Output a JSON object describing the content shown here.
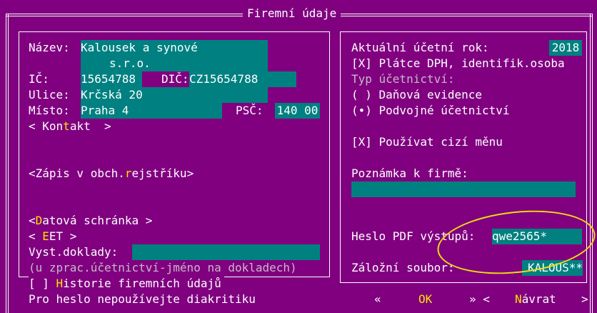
{
  "window": {
    "title": "Firemní údaje"
  },
  "left": {
    "nazev_label": "Název:",
    "nazev_line1": "Kalousek a synové",
    "nazev_line2": "s.r.o.",
    "ic_label": "IČ:",
    "ic_value": "15654788",
    "dic_label": "DIČ:",
    "dic_value": "CZ15654788",
    "ulice_label": "Ulice:",
    "ulice_value": "Krčská 20",
    "misto_label": "Místo:",
    "misto_value": "Praha 4",
    "psc_label": "PSČ:",
    "psc_value": "140 00",
    "kontakt": {
      "pre": "< Kon",
      "hot": "t",
      "post": "akt  >"
    },
    "zapis": {
      "pre": "<Zápis v obch.",
      "hot": "r",
      "post": "ejstříku>"
    },
    "datova": {
      "pre": "<",
      "hot": "D",
      "post": "atová schránka >"
    },
    "eet": {
      "pre": "< ",
      "hot": "E",
      "post": "ET >"
    },
    "vyst_label": "Vyst.doklady:",
    "vyst_value": "",
    "note": "(u zprac.účetnictví-jméno na dokladech)",
    "historie": {
      "pre": "[ ] ",
      "hot": "H",
      "post": "istorie firemních údajů"
    }
  },
  "right": {
    "rok_label": "Aktuální účetní rok:",
    "rok_value": "2018",
    "platce": "[X] Plátce DPH, identifik.osoba",
    "typ_label": "Typ účetnictví:",
    "danova": "( ) Daňová evidence",
    "podvojne": "(•) Podvojné účetnictví",
    "cizi_mena": "[X] Používat cizí měnu",
    "poznamka_label": "Poznámka k firmě:",
    "poznamka_value": "",
    "heslo_label": "Heslo PDF výstupů:",
    "heslo_value": "qwe2565*",
    "zalozni_label": "Záložní soubor:",
    "zalozni_value": "KALOUS**"
  },
  "footer": {
    "hint": "Pro heslo nepoužívejte diakritiku",
    "prev": "«",
    "ok": "OK",
    "next_pre": "» <",
    "navrat_hot": "N",
    "navrat_rest": "ávrat",
    "end": ">"
  },
  "colors": {
    "background": "#800080",
    "field": "#008080",
    "hotkey": "#ffe000",
    "highlight": "#f0dc10"
  }
}
